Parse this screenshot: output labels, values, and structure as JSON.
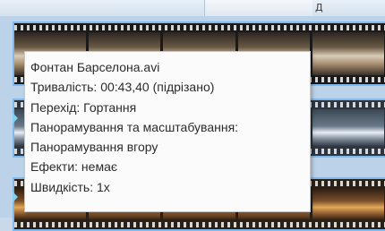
{
  "header": {
    "top_text": "Д"
  },
  "tooltip": {
    "filename": "Фонтан Барселона.avi",
    "duration": "Тривалість: 00:43,40 (підрізано)",
    "transition": "Перехід: Гортання",
    "pan_zoom_label": "Панорамування та масштабування:",
    "pan_zoom_value": "Панорамування вгору",
    "effects": "Ефекти: немає",
    "speed": "Швидкість: 1x"
  }
}
